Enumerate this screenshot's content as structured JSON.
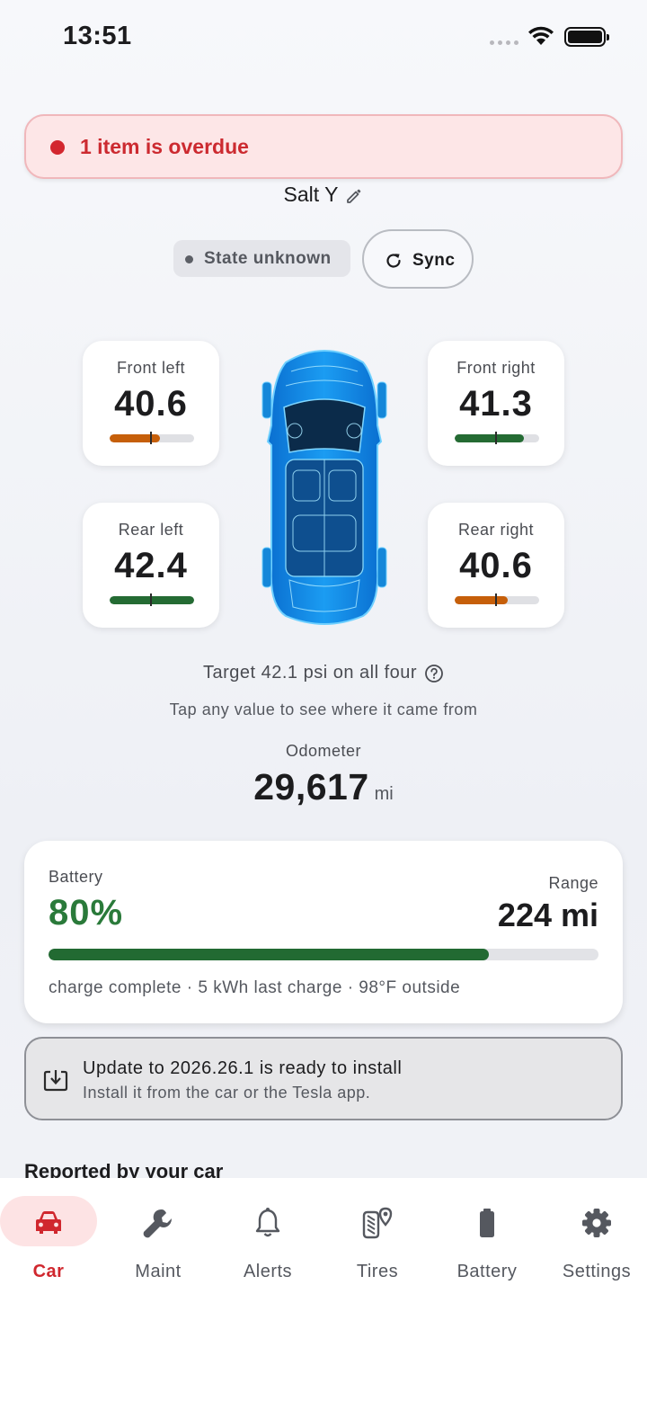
{
  "status_bar": {
    "time": "13:51"
  },
  "alert_banner": {
    "text": "1 item is overdue",
    "color": "#d3272f"
  },
  "vehicle": {
    "name": "Salt Y"
  },
  "state": {
    "label": "State unknown"
  },
  "sync": {
    "label": "Sync"
  },
  "tires": {
    "front_left": {
      "label": "Front left",
      "value": "40.6",
      "level": 0.6,
      "color": "#c65f0a"
    },
    "front_right": {
      "label": "Front right",
      "value": "41.3",
      "level": 0.82,
      "color": "#246b33"
    },
    "rear_left": {
      "label": "Rear left",
      "value": "42.4",
      "level": 1.0,
      "color": "#246b33"
    },
    "rear_right": {
      "label": "Rear right",
      "value": "40.6",
      "level": 0.63,
      "color": "#c65f0a"
    }
  },
  "target_text": "Target 42.1 psi on all four",
  "tap_hint": "Tap any value to see where it came from",
  "odometer": {
    "label": "Odometer",
    "value": "29,617",
    "unit": "mi"
  },
  "battery": {
    "label": "Battery",
    "percent": "80%",
    "level": 0.8,
    "range_label": "Range",
    "range_value": "224 mi",
    "meta": "charge complete · 5 kWh last charge · 98°F outside"
  },
  "update": {
    "title": "Update to 2026.26.1 is ready to install",
    "subtitle": "Install it from the car or the Tesla app."
  },
  "section_heading": "Reported by your car",
  "tabs": [
    {
      "label": "Car",
      "icon": "car-icon",
      "active": true
    },
    {
      "label": "Maint",
      "icon": "wrench-icon"
    },
    {
      "label": "Alerts",
      "icon": "bell-icon"
    },
    {
      "label": "Tires",
      "icon": "tire-location-icon"
    },
    {
      "label": "Battery",
      "icon": "battery-icon"
    },
    {
      "label": "Settings",
      "icon": "gear-icon"
    }
  ],
  "colors": {
    "accent_red": "#d0272e",
    "battery_green": "#226a32",
    "warn_orange": "#c65f0a"
  }
}
